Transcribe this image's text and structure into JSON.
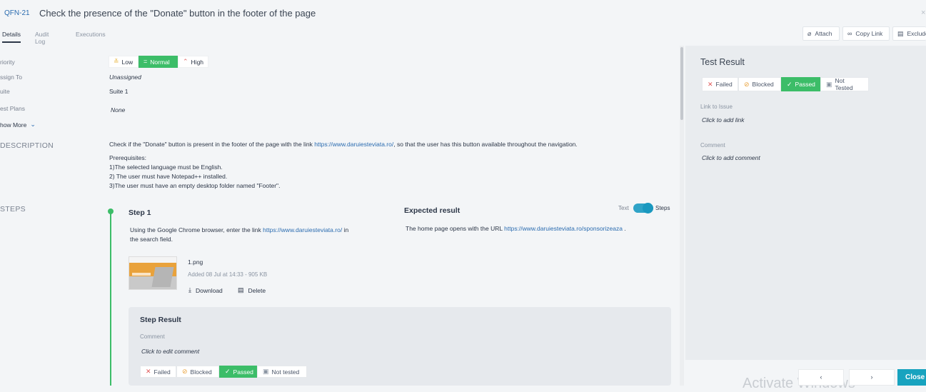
{
  "header": {
    "key": "QFN-21",
    "title": "Check the presence of the \"Donate\" button in the footer of the page",
    "close_icon": "×"
  },
  "tabs": [
    "Details",
    "Audit Log",
    "Executions"
  ],
  "toolbar": {
    "attach": "Attach",
    "copy_link": "Copy Link",
    "exclude": "Exclude"
  },
  "fields": {
    "priority_label": "riority",
    "assign_label": "ssign To",
    "suite_label": "uite",
    "plans_label": "est Plans",
    "show_more": "how More",
    "assign_value": "Unassigned",
    "suite_value": "Suite 1",
    "plans_value": "None"
  },
  "priority": {
    "low": "Low",
    "normal": "Normal",
    "high": "High",
    "selected": "Normal"
  },
  "description": {
    "label": "DESCRIPTION",
    "text_before": "Check if the \"Donate\" button is present in the footer of the page with the link ",
    "link": "https://www.daruiesteviata.ro/",
    "text_after": ", so that the user has this button available throughout the navigation.",
    "prereq_title": "Prerequisites:",
    "prereq_1": "1)The selected language must be English.",
    "prereq_2": "2) The user must have Notepad++ installed.",
    "prereq_3": "3)The user must have an empty desktop folder named \"Footer\"."
  },
  "steps": {
    "label": "STEPS",
    "toggle_text": "Text",
    "toggle_steps": "Steps",
    "step_title": "Step 1",
    "step_text": "Using the Google Chrome browser, enter the link ",
    "step_link": "https://www.daruiesteviata.ro/",
    "step_text2": " in",
    "step_text3": "the search field.",
    "expected_title": "Expected result",
    "expected_text": "The home page opens with the URL ",
    "expected_link": "https://www.daruiesteviata.ro/sponsorizeaza",
    "expected_after": " .",
    "file_name": "1.png",
    "file_meta": "Added 08 Jul at 14:33 - 905 KB",
    "download": "Download",
    "delete": "Delete"
  },
  "step_result": {
    "title": "Step Result",
    "comment_label": "Comment",
    "comment_placeholder": "Click to edit comment",
    "failed": "Failed",
    "blocked": "Blocked",
    "passed": "Passed",
    "not_tested": "Not tested",
    "selected": "Passed"
  },
  "test_result": {
    "title": "Test Result",
    "failed": "Failed",
    "blocked": "Blocked",
    "passed": "Passed",
    "not_tested": "Not Tested",
    "selected": "Passed",
    "link_label": "Link to Issue",
    "link_placeholder": "Click to add link",
    "comment_label": "Comment",
    "comment_placeholder": "Click to add comment"
  },
  "footer": {
    "prev": "‹",
    "next": "›",
    "close": "Close",
    "watermark": "Activate Windows"
  },
  "colors": {
    "green": "#3cbd68",
    "link": "#2b6cb0",
    "teal": "#18a3bf"
  }
}
